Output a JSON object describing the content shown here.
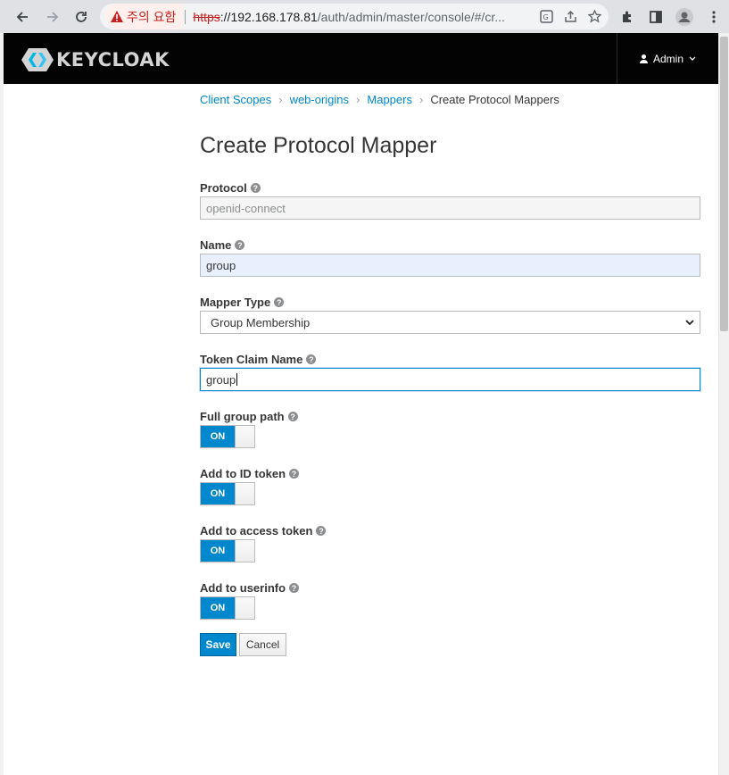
{
  "browser": {
    "security_warning": "주의 요함",
    "url_scheme": "https",
    "url_host": "://192.168.178.81",
    "url_path": "/auth/admin/master/console/#/cr..."
  },
  "header": {
    "logo_text": "KEYCLOAK",
    "user_label": "Admin"
  },
  "breadcrumb": {
    "items": [
      "Client Scopes",
      "web-origins",
      "Mappers"
    ],
    "current": "Create Protocol Mappers"
  },
  "page_title": "Create Protocol Mapper",
  "form": {
    "protocol": {
      "label": "Protocol",
      "value": "openid-connect"
    },
    "name": {
      "label": "Name",
      "value": "group"
    },
    "mapper_type": {
      "label": "Mapper Type",
      "value": "Group Membership"
    },
    "token_claim_name": {
      "label": "Token Claim Name",
      "value": "group"
    },
    "full_group_path": {
      "label": "Full group path",
      "state": "ON"
    },
    "add_to_id_token": {
      "label": "Add to ID token",
      "state": "ON"
    },
    "add_to_access_token": {
      "label": "Add to access token",
      "state": "ON"
    },
    "add_to_userinfo": {
      "label": "Add to userinfo",
      "state": "ON"
    }
  },
  "buttons": {
    "save": "Save",
    "cancel": "Cancel"
  },
  "colors": {
    "accent": "#0088ce",
    "header_bg": "#030303"
  }
}
